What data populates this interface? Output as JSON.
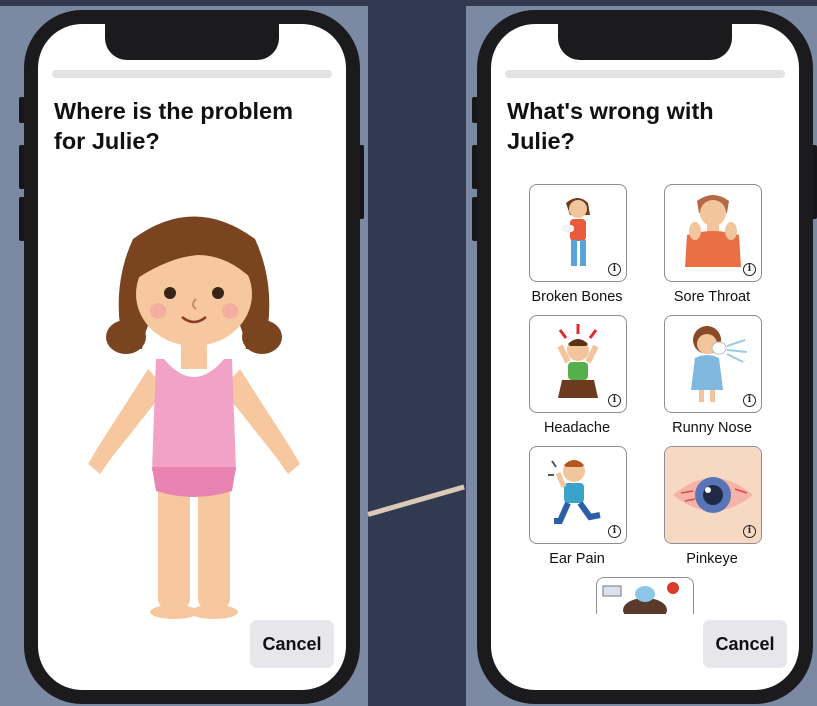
{
  "left_screen": {
    "title": "Where is the problem for Julie?",
    "cancel_label": "Cancel",
    "figure_icon": "girl-body-figure"
  },
  "right_screen": {
    "title": "What's wrong with Julie?",
    "cancel_label": "Cancel",
    "conditions": [
      {
        "label": "Broken Bones",
        "icon": "broken-bones-icon"
      },
      {
        "label": "Sore Throat",
        "icon": "sore-throat-icon"
      },
      {
        "label": "Headache",
        "icon": "headache-icon"
      },
      {
        "label": "Runny Nose",
        "icon": "runny-nose-icon"
      },
      {
        "label": "Ear Pain",
        "icon": "ear-pain-icon"
      },
      {
        "label": "Pinkeye",
        "icon": "pinkeye-icon"
      },
      {
        "label": "",
        "icon": "sick-kit-icon"
      }
    ],
    "info_glyph": "i"
  },
  "colors": {
    "background": "#313a50",
    "accent_panel": "#7b8aa2",
    "cancel_button": "#e6e6eb"
  }
}
